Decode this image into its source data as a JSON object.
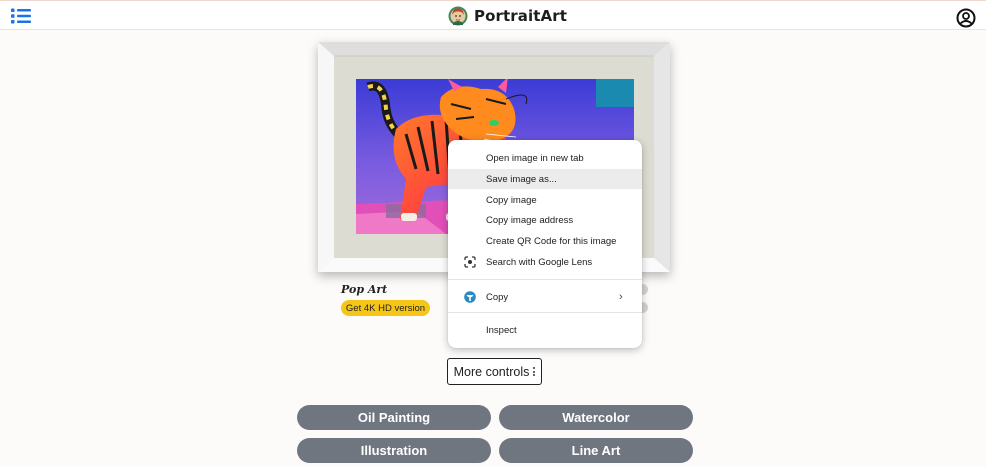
{
  "header": {
    "brand": "PortraitArt",
    "menu_icon": "list-icon",
    "logo_icon": "portrait-logo-icon",
    "account_icon": "user-circle-icon"
  },
  "artwork": {
    "title": "Pop Art",
    "hd_button_label": "Get 4K HD version"
  },
  "context_menu": {
    "items": [
      {
        "label": "Open image in new tab"
      },
      {
        "label": "Save image as..."
      },
      {
        "label": "Copy image"
      },
      {
        "label": "Copy image address"
      },
      {
        "label": "Create QR Code for this image"
      },
      {
        "label": "Search with Google Lens",
        "icon": "google-lens-icon"
      },
      {
        "label": "Copy",
        "icon": "copy-extension-icon"
      },
      {
        "label": "Inspect"
      }
    ],
    "highlighted": "Save image as..."
  },
  "controls": {
    "more_label": "More controls",
    "more_icon": "kebab-icon"
  },
  "styles": {
    "items": [
      {
        "label": "Oil Painting"
      },
      {
        "label": "Watercolor"
      },
      {
        "label": "Illustration"
      },
      {
        "label": "Line Art"
      }
    ]
  },
  "colors": {
    "accent_yellow": "#f5c518",
    "style_button": "#707680",
    "frame_white": "#f2f2f2",
    "mat": "#dcdcd2"
  }
}
